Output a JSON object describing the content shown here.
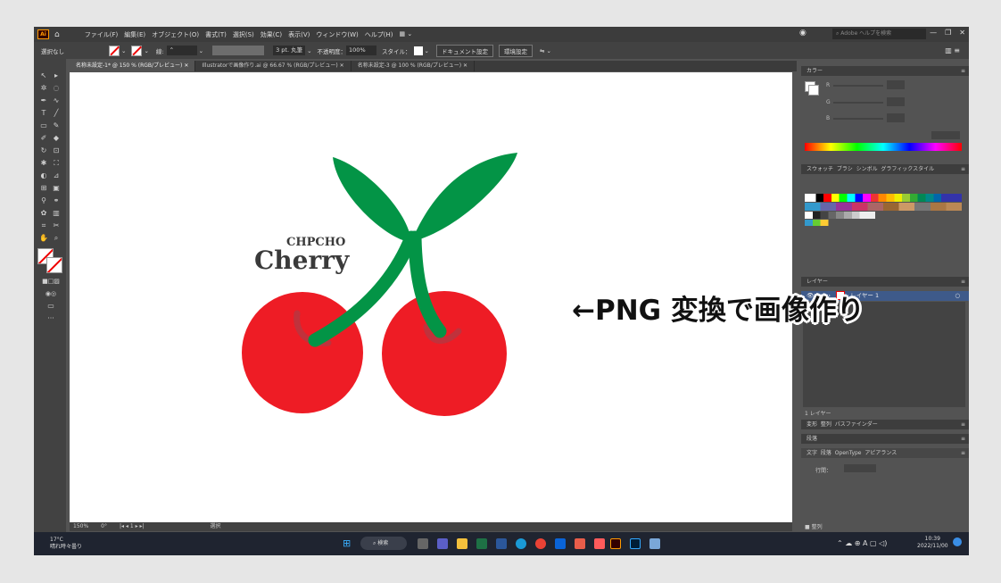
{
  "menubar": {
    "app_icon": "Ai",
    "items": [
      "ファイル(F)",
      "編集(E)",
      "オブジェクト(O)",
      "書式(T)",
      "選択(S)",
      "効果(C)",
      "表示(V)",
      "ウィンドウ(W)",
      "ヘルプ(H)"
    ],
    "search_placeholder": "Adobe ヘルプを検索"
  },
  "controlbar": {
    "selection_label": "選択なし",
    "stroke_label": "線:",
    "stroke_style": "3 pt. 丸筆",
    "opacity_label": "不透明度：",
    "opacity_value": "100%",
    "style_label": "スタイル：",
    "doc_settings": "ドキュメント設定",
    "env_settings": "環境設定"
  },
  "tabs": [
    "名称未設定-1* @ 150 % (RGB/プレビュー)",
    "Illustratorで画像作り.ai @ 66.67 % (RGB/プレビュー)",
    "名称未設定-3 @ 100 % (RGB/プレビュー)"
  ],
  "artwork": {
    "text_top": "CHPCHO",
    "text_bottom": "Cherry",
    "colors": {
      "cherry": "#ee1c25",
      "leaf": "#039446",
      "stem_mark": "#c0323c",
      "text": "#3a3a3a"
    }
  },
  "annotation": "←PNG 変換で画像作り",
  "statusbar": {
    "zoom": "150%",
    "angle": "0°",
    "page": "1",
    "tool": "選択"
  },
  "panels": {
    "color_tab": "カラー",
    "color_labels": [
      "R",
      "G",
      "B"
    ],
    "swatch_tabs": [
      "スウォッチ",
      "ブラシ",
      "シンボル",
      "グラフィックスタイル"
    ],
    "layers_tab": "レイヤー",
    "layer_name": "レイヤー 1",
    "layer_count": "1 レイヤー",
    "bottom_tabs": [
      "変形",
      "整列",
      "パスファインダー"
    ],
    "paragraph_tab": "段落",
    "char_tabs": [
      "文字",
      "段落",
      "OpenType",
      "アピアランス"
    ],
    "font_size_label": "行間：",
    "align_label": "整列"
  },
  "taskbar": {
    "search": "検索",
    "time": "10:39",
    "date": "2022/11/00",
    "weather": "17°C",
    "weather_text": "晴れ時々曇り"
  }
}
